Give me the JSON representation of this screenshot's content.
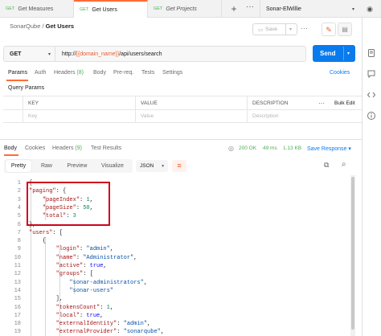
{
  "tabs": [
    {
      "method": "GET",
      "label": "Get Measures",
      "italic": false
    },
    {
      "method": "GET",
      "label": "Get Users",
      "italic": false
    },
    {
      "method": "GET",
      "label": "Get Projects",
      "italic": true
    }
  ],
  "tab_actions": {
    "new_tab": "+",
    "more": "···"
  },
  "environment": {
    "name": "Sonar-ElWillie",
    "caret": "▾"
  },
  "breadcrumb": {
    "collection": "SonarQube",
    "separator": "/",
    "request": "Get Users"
  },
  "save": {
    "label": "Save",
    "caret": "▾"
  },
  "request": {
    "method": "GET",
    "url_prefix": "http://",
    "url_var": "{{domain_name}}",
    "url_suffix": "/api/users/search"
  },
  "send": {
    "label": "Send",
    "caret": "▾"
  },
  "request_tabs": [
    {
      "label": "Params",
      "count": ""
    },
    {
      "label": "Auth",
      "count": ""
    },
    {
      "label": "Headers",
      "count": "(8)"
    },
    {
      "label": "Body",
      "count": ""
    },
    {
      "label": "Pre-req.",
      "count": ""
    },
    {
      "label": "Tests",
      "count": ""
    },
    {
      "label": "Settings",
      "count": ""
    }
  ],
  "cookies_link": "Cookies",
  "query_params": {
    "title": "Query Params",
    "headers": {
      "key": "KEY",
      "value": "VALUE",
      "description": "DESCRIPTION",
      "more": "···",
      "bulk": "Bulk Edit"
    },
    "placeholder": {
      "key": "Key",
      "value": "Value",
      "description": "Description"
    }
  },
  "response_tabs": [
    {
      "label": "Body",
      "count": ""
    },
    {
      "label": "Cookies",
      "count": ""
    },
    {
      "label": "Headers",
      "count": "(9)"
    },
    {
      "label": "Test Results",
      "count": ""
    }
  ],
  "response_status": {
    "status": "200 OK",
    "time": "49 ms",
    "size": "1.13 KB",
    "save_label": "Save Response",
    "save_caret": "▾"
  },
  "format_buttons": [
    "Pretty",
    "Raw",
    "Preview",
    "Visualize"
  ],
  "format_select": {
    "value": "JSON",
    "caret": "▾"
  },
  "colors": {
    "accent": "#ff6c37",
    "send": "#097bed",
    "highlight": "#d0021b",
    "method_get": "#4caf50"
  },
  "code_lines": [
    {
      "n": "1",
      "text": "{"
    },
    {
      "n": "2",
      "text": "    \"paging\": {"
    },
    {
      "n": "3",
      "text": "        \"pageIndex\": 1,"
    },
    {
      "n": "4",
      "text": "        \"pageSize\": 50,"
    },
    {
      "n": "5",
      "text": "        \"total\": 3"
    },
    {
      "n": "6",
      "text": "    },"
    },
    {
      "n": "7",
      "text": "    \"users\": ["
    },
    {
      "n": "8",
      "text": "        {"
    },
    {
      "n": "9",
      "text": "            \"login\": \"admin\","
    },
    {
      "n": "10",
      "text": "            \"name\": \"Administrator\","
    },
    {
      "n": "11",
      "text": "            \"active\": true,"
    },
    {
      "n": "12",
      "text": "            \"groups\": ["
    },
    {
      "n": "13",
      "text": "                \"sonar-administrators\","
    },
    {
      "n": "14",
      "text": "                \"sonar-users\""
    },
    {
      "n": "15",
      "text": "            ],"
    },
    {
      "n": "16",
      "text": "            \"tokensCount\": 1,"
    },
    {
      "n": "17",
      "text": "            \"local\": true,"
    },
    {
      "n": "18",
      "text": "            \"externalIdentity\": \"admin\","
    },
    {
      "n": "19",
      "text": "            \"externalProvider\": \"sonarqube\","
    }
  ],
  "icons": {
    "edit": "✎",
    "comment": "▤",
    "copy": "⧉",
    "search": "⌕",
    "wrap": "≡",
    "globe": "◎",
    "eye": "◉",
    "more": "···"
  }
}
